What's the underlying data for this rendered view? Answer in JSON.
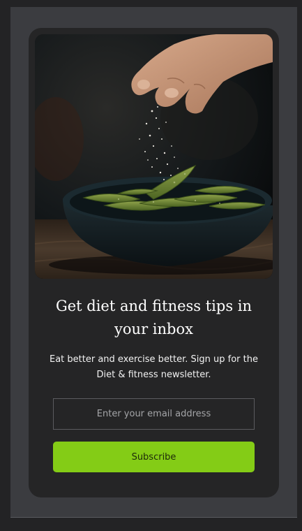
{
  "newsletter": {
    "image_alt": "Hand sprinkling salt over edamame pods in a dark bowl",
    "title": "Get diet and fitness tips in your inbox",
    "description": "Eat better and exercise better. Sign up for the Diet & fitness newsletter.",
    "email_placeholder": "Enter your email address",
    "email_value": "",
    "subscribe_label": "Subscribe"
  },
  "colors": {
    "page_background": "#232325",
    "panel_background": "#3b3c40",
    "card_background": "#252526",
    "accent": "#84cc16",
    "input_border": "#5b5c60",
    "text_primary": "#ffffff"
  }
}
